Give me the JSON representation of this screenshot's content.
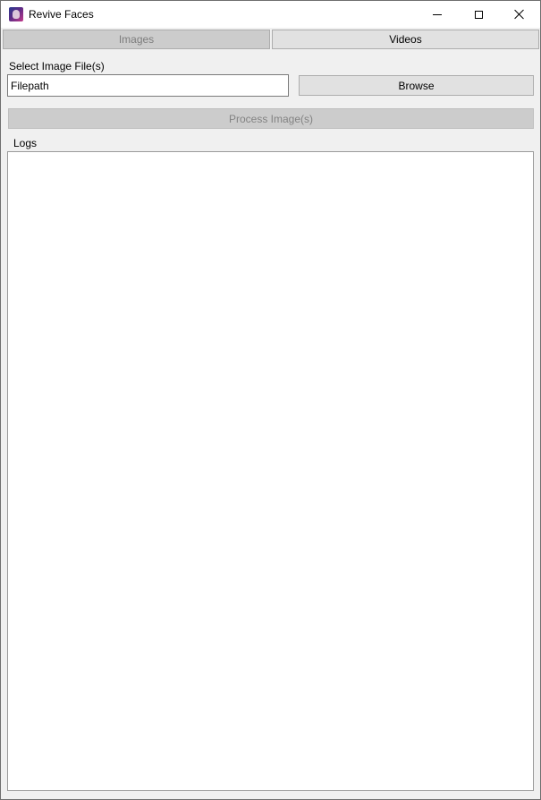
{
  "window": {
    "title": "Revive Faces",
    "icon": "app-face-icon"
  },
  "tabs": [
    {
      "label": "Images",
      "state": "selected-disabled"
    },
    {
      "label": "Videos",
      "state": "normal"
    }
  ],
  "image_panel": {
    "select_label": "Select Image File(s)",
    "filepath_value": "Filepath",
    "browse_label": "Browse",
    "process_label": "Process Image(s)",
    "logs_label": "Logs",
    "logs_content": ""
  },
  "colors": {
    "window_bg": "#f0f0f0",
    "button_bg": "#e1e1e1",
    "disabled_bg": "#cccccc",
    "disabled_text": "#838383"
  }
}
